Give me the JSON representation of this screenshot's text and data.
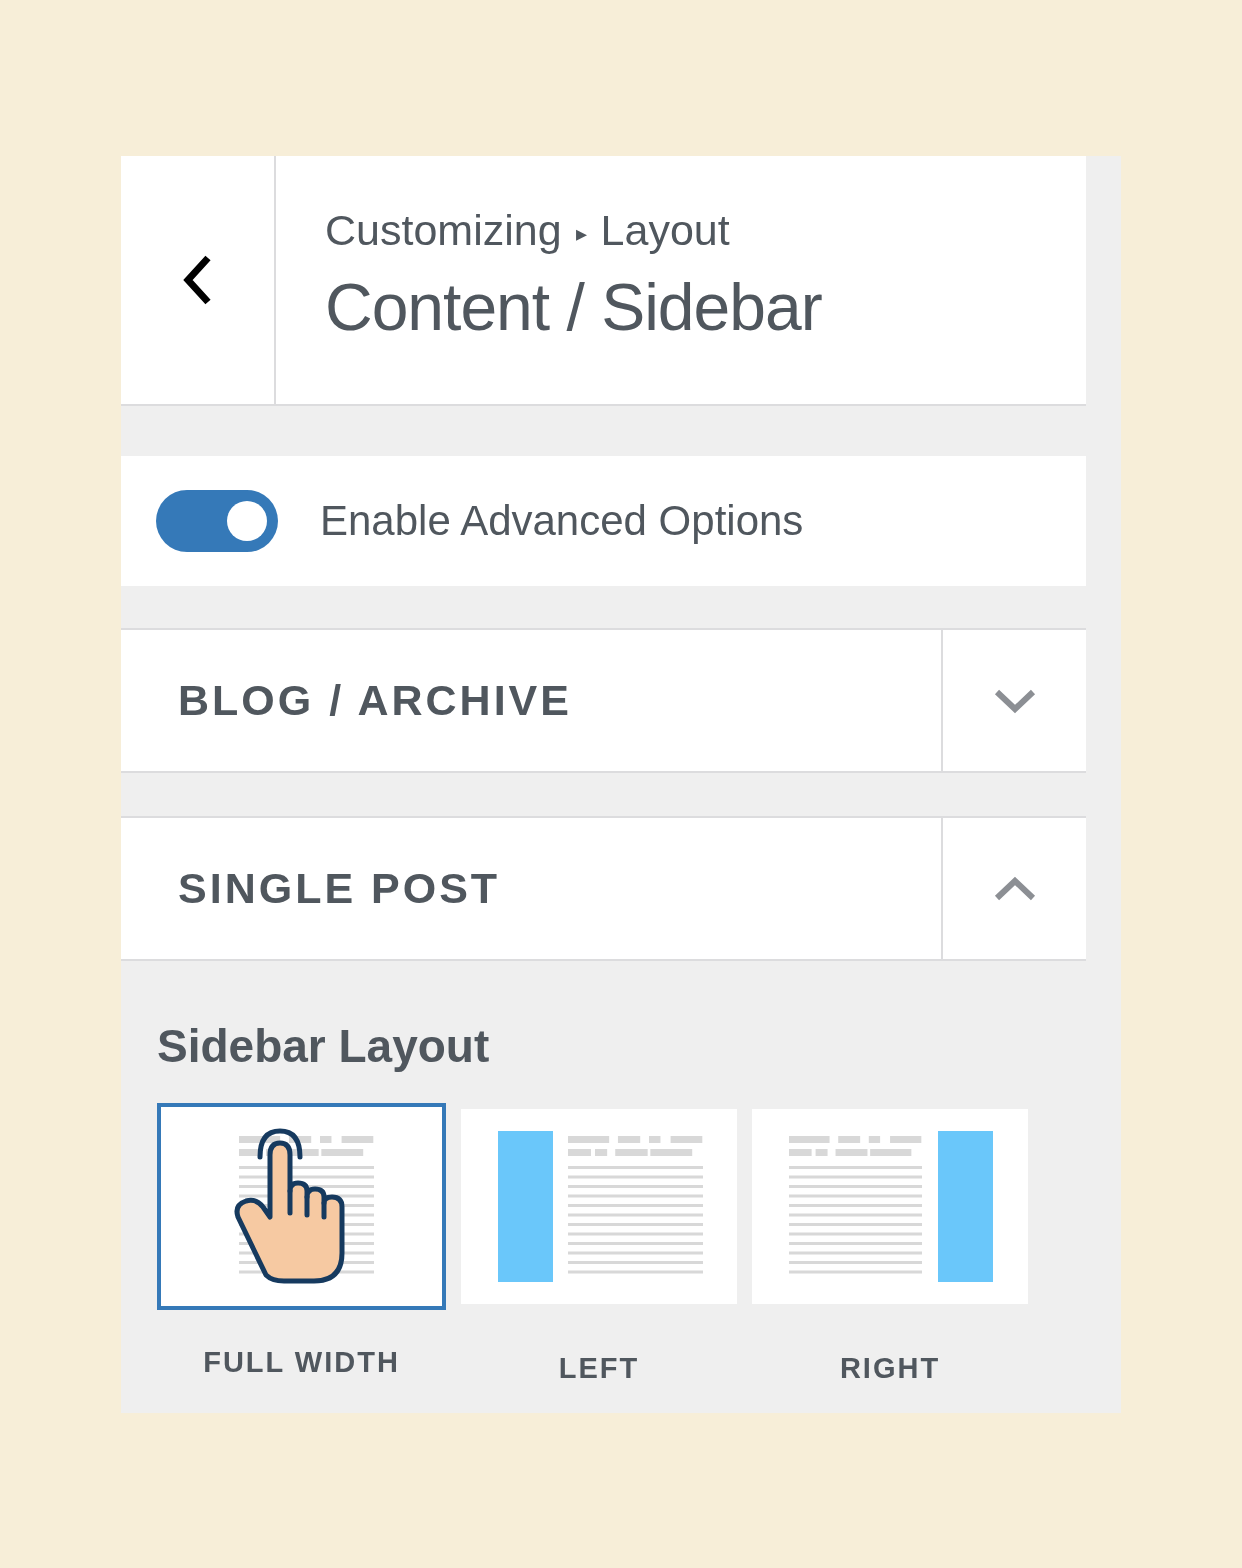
{
  "header": {
    "breadcrumb": [
      "Customizing",
      "Layout"
    ],
    "separator": "▸",
    "title": "Content / Sidebar"
  },
  "toggle": {
    "label": "Enable Advanced Options",
    "on": true
  },
  "sections": [
    {
      "title": "BLOG / ARCHIVE",
      "expanded": false
    },
    {
      "title": "SINGLE POST",
      "expanded": true
    }
  ],
  "sidebar_layout": {
    "heading": "Sidebar Layout",
    "options": [
      {
        "kind": "full",
        "label": "FULL WIDTH",
        "selected": true
      },
      {
        "kind": "left",
        "label": "LEFT",
        "selected": false
      },
      {
        "kind": "right",
        "label": "RIGHT",
        "selected": false
      }
    ]
  }
}
